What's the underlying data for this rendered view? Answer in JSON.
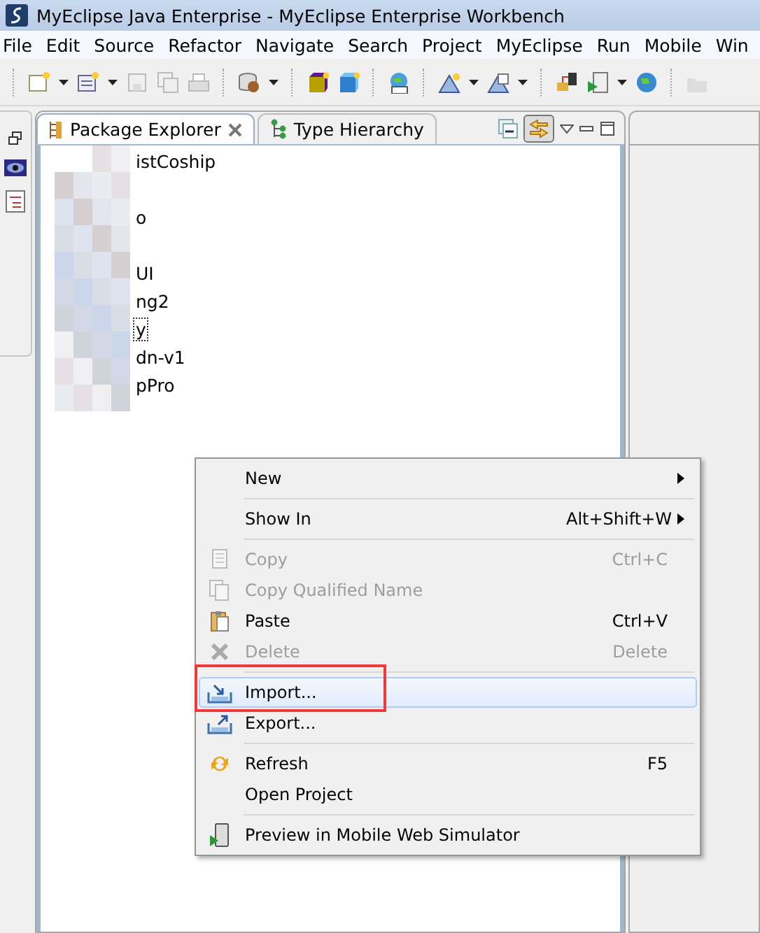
{
  "window": {
    "title": "MyEclipse Java Enterprise - MyEclipse Enterprise Workbench"
  },
  "menubar": [
    "File",
    "Edit",
    "Source",
    "Refactor",
    "Navigate",
    "Search",
    "Project",
    "MyEclipse",
    "Run",
    "Mobile",
    "Win"
  ],
  "views": {
    "tabs": [
      {
        "label": "Package Explorer",
        "selected": true,
        "closable": true
      },
      {
        "label": "Type Hierarchy",
        "selected": false,
        "closable": false
      }
    ],
    "link_with_editor": {
      "on": true
    }
  },
  "tree": [
    {
      "label": "istCoship",
      "focused": false
    },
    {
      "label": "o",
      "focused": false
    },
    {
      "label": "UI",
      "focused": false
    },
    {
      "label": "ng2",
      "focused": false
    },
    {
      "label": "y",
      "focused": true
    },
    {
      "label": "dn-v1",
      "focused": false
    },
    {
      "label": "pPro",
      "focused": false
    }
  ],
  "context_menu": [
    {
      "kind": "item",
      "label": "New",
      "submenu": true,
      "disabled": false,
      "selected": false,
      "marked": false
    },
    {
      "kind": "separator"
    },
    {
      "kind": "item",
      "label": "Show In",
      "shortcut": "Alt+Shift+W",
      "submenu": true,
      "disabled": false,
      "selected": false,
      "marked": false
    },
    {
      "kind": "separator"
    },
    {
      "kind": "item",
      "label": "Copy",
      "shortcut": "Ctrl+C",
      "submenu": false,
      "disabled": true,
      "selected": false,
      "marked": false
    },
    {
      "kind": "item",
      "label": "Copy Qualified Name",
      "submenu": false,
      "disabled": true,
      "selected": false,
      "marked": false
    },
    {
      "kind": "item",
      "label": "Paste",
      "shortcut": "Ctrl+V",
      "submenu": false,
      "disabled": false,
      "selected": false,
      "marked": false
    },
    {
      "kind": "item",
      "label": "Delete",
      "shortcut": "Delete",
      "submenu": false,
      "disabled": true,
      "selected": false,
      "marked": false
    },
    {
      "kind": "separator"
    },
    {
      "kind": "item",
      "label": "Import...",
      "submenu": false,
      "disabled": false,
      "selected": true,
      "marked": true
    },
    {
      "kind": "item",
      "label": "Export...",
      "submenu": false,
      "disabled": false,
      "selected": false,
      "marked": false
    },
    {
      "kind": "separator"
    },
    {
      "kind": "item",
      "label": "Refresh",
      "shortcut": "F5",
      "submenu": false,
      "disabled": false,
      "selected": false,
      "marked": false
    },
    {
      "kind": "item",
      "label": "Open Project",
      "submenu": false,
      "disabled": false,
      "selected": false,
      "marked": false
    },
    {
      "kind": "separator"
    },
    {
      "kind": "item",
      "label": "Preview in Mobile Web Simulator",
      "submenu": false,
      "disabled": false,
      "selected": false,
      "marked": false
    }
  ]
}
